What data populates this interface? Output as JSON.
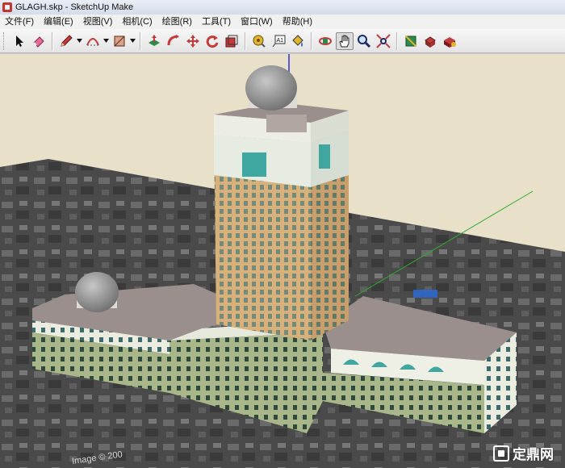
{
  "window": {
    "title": "GLAGH.skp - SketchUp Make"
  },
  "menu": [
    "文件(F)",
    "编辑(E)",
    "视图(V)",
    "相机(C)",
    "绘图(R)",
    "工具(T)",
    "窗口(W)",
    "帮助(H)"
  ],
  "toolbar": {
    "tools": [
      {
        "name": "select-tool",
        "icon": "arrow-cursor-icon"
      },
      {
        "name": "eraser-tool",
        "icon": "eraser-icon"
      },
      {
        "name": "line-tool",
        "icon": "pencil-icon"
      },
      {
        "name": "arc-tool",
        "icon": "arc-icon"
      },
      {
        "name": "rectangle-tool",
        "icon": "rectangle-icon"
      },
      {
        "name": "push-pull-tool",
        "icon": "push-pull-icon"
      },
      {
        "name": "follow-me-tool",
        "icon": "follow-me-icon"
      },
      {
        "name": "move-tool",
        "icon": "move-icon"
      },
      {
        "name": "rotate-tool",
        "icon": "rotate-icon"
      },
      {
        "name": "scale-tool",
        "icon": "scale-icon"
      },
      {
        "name": "tape-measure-tool",
        "icon": "tape-measure-icon"
      },
      {
        "name": "text-tool",
        "icon": "text-icon"
      },
      {
        "name": "paint-bucket-tool",
        "icon": "paint-bucket-icon"
      },
      {
        "name": "orbit-tool",
        "icon": "orbit-icon"
      },
      {
        "name": "pan-tool",
        "icon": "hand-icon",
        "active": true
      },
      {
        "name": "zoom-tool",
        "icon": "magnifier-icon"
      },
      {
        "name": "zoom-extents-tool",
        "icon": "zoom-extents-icon"
      },
      {
        "name": "warehouse-tool",
        "icon": "warehouse-icon"
      },
      {
        "name": "share-model-tool",
        "icon": "share-model-icon"
      },
      {
        "name": "extension-warehouse-tool",
        "icon": "extension-icon"
      }
    ],
    "text_tool_glyph": "A1"
  },
  "viewport": {
    "image_credit": "Image © 200",
    "watermark": "定鼎网"
  },
  "colors": {
    "sky": "#e8e0c8",
    "ground": "#4b4b4b",
    "facade_main": "#d9b07a",
    "facade_lower": "#a8b68a",
    "window_teal": "#3fa6a0",
    "roof": "#9a8f8c",
    "dome": "#9a9a9a",
    "axis_green": "#2fae2f",
    "axis_blue": "#2a2ad8"
  }
}
